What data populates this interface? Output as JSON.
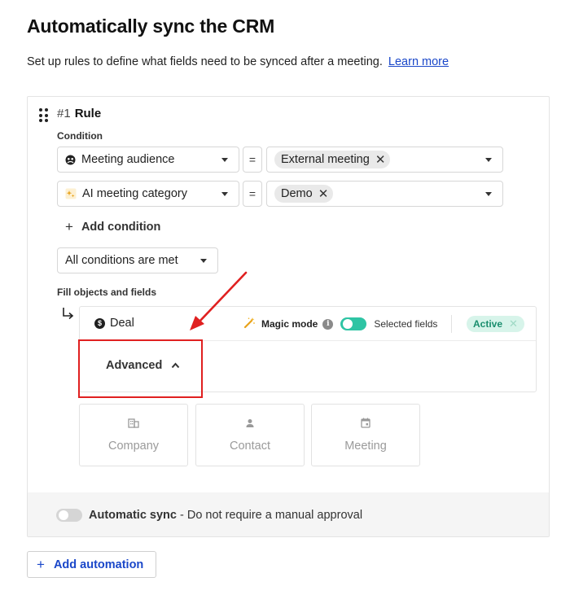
{
  "page": {
    "title": "Automatically sync the CRM",
    "subtitle": "Set up rules to define what fields need to be synced after a meeting.",
    "learn_more": "Learn more"
  },
  "rule": {
    "number": "#1",
    "name": "Rule",
    "condition_label": "Condition",
    "conditions": [
      {
        "field": "Meeting audience",
        "field_icon": "audience-icon",
        "operator": "=",
        "value": "External meeting"
      },
      {
        "field": "AI meeting category",
        "field_icon": "ai-sparkle-icon",
        "operator": "=",
        "value": "Demo"
      }
    ],
    "add_condition": "Add condition",
    "match_mode": "All conditions are met",
    "fill_label": "Fill objects and fields"
  },
  "deal": {
    "title": "Deal",
    "magic_mode_label": "Magic mode",
    "selected_fields_label": "Selected fields",
    "status": "Active",
    "advanced_label": "Advanced"
  },
  "objects": [
    {
      "label": "Company",
      "icon": "building-icon"
    },
    {
      "label": "Contact",
      "icon": "person-icon"
    },
    {
      "label": "Meeting",
      "icon": "calendar-icon"
    }
  ],
  "footer": {
    "sync_title": "Automatic sync",
    "sync_desc": "- Do not require a manual approval"
  },
  "add_automation": "Add automation",
  "colors": {
    "accent_link": "#1a47c9",
    "toggle_on": "#2ec4a4",
    "active_badge_bg": "#d7f4ea",
    "active_badge_text": "#1a8e6e",
    "annotation_red": "#e02020"
  }
}
